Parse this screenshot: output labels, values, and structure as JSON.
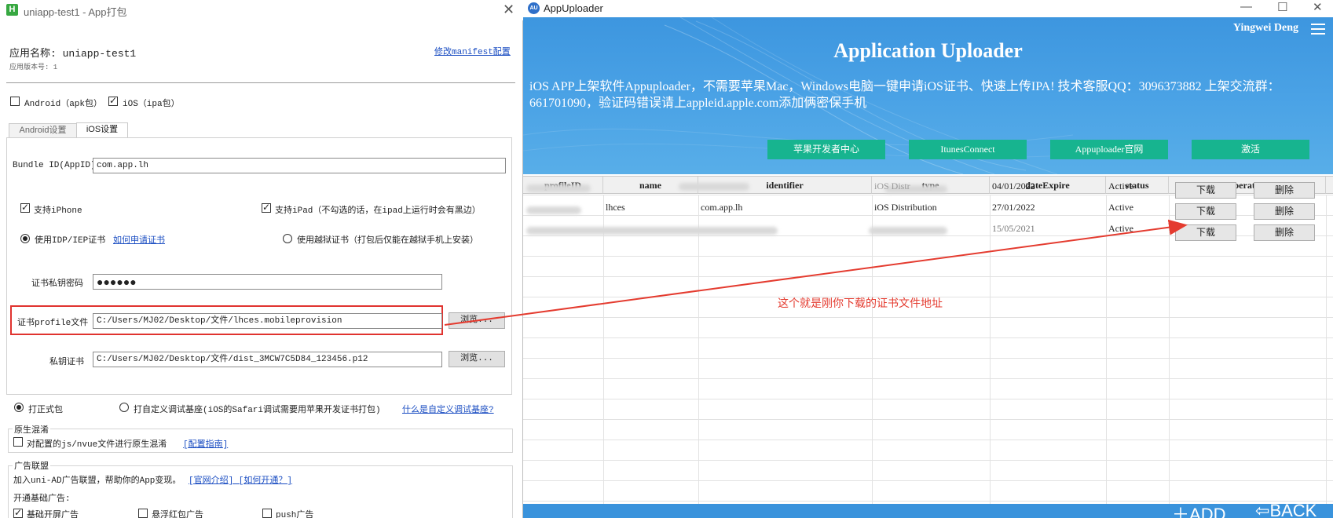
{
  "left": {
    "title": "uniapp-test1 - App打包",
    "app_icon": "H",
    "app_name_label": "应用名称: uniapp-test1",
    "app_version_label": "应用版本号: 1",
    "manifest_link": "修改manifest配置",
    "android_pkg_label": "Android（apk包）",
    "android_pkg_checked": false,
    "ios_pkg_label": "iOS（ipa包）",
    "ios_pkg_checked": true,
    "tabs": [
      {
        "label": "Android设置",
        "active": false
      },
      {
        "label": "iOS设置",
        "active": true
      }
    ],
    "bundle_id_label": "Bundle ID(AppID)",
    "bundle_id_value": "com.app.lh",
    "support_iphone_label": "支持iPhone",
    "support_iphone_checked": true,
    "support_ipad_label": "支持iPad（不勾选的话，在ipad上运行时会有黑边）",
    "support_ipad_checked": true,
    "idp_label": "使用IDP/IEP证书",
    "idp_checked": true,
    "how_apply_link": "如何申请证书",
    "jailbreak_label": "使用越狱证书（打包后仅能在越狱手机上安装）",
    "jailbreak_checked": false,
    "cert_password_label": "证书私钥密码",
    "cert_password_value": "●●●●●●",
    "profile_label": "证书profile文件",
    "profile_value": "C:/Users/MJ02/Desktop/文件/lhces.mobileprovision",
    "browse_label": "浏览...",
    "private_cert_label": "私钥证书",
    "private_cert_value": "C:/Users/MJ02/Desktop/文件/dist_3MCW7C5D84_123456.p12",
    "formal_pkg_label": "打正式包",
    "formal_pkg_checked": true,
    "custom_base_label": "打自定义调试基座(iOS的Safari调试需要用苹果开发证书打包)",
    "custom_base_checked": false,
    "custom_base_link": "什么是自定义调试基座?",
    "native_obf_title": "原生混淆",
    "native_obf_label": "对配置的js/nvue文件进行原生混淆",
    "native_obf_checked": false,
    "native_obf_link": "[配置指南]",
    "ad_title": "广告联盟",
    "ad_desc": "加入uni-AD广告联盟，帮助你的App变现。",
    "ad_links": "[官网介绍] [如何开通？]",
    "ad_basic_label": "开通基础广告:",
    "ad_options": [
      {
        "label": "基础开屏广告",
        "checked": true
      },
      {
        "label": "悬浮红包广告",
        "checked": false
      },
      {
        "label": "push广告",
        "checked": false
      }
    ]
  },
  "right": {
    "title": "AppUploader",
    "app_icon": "AU",
    "user": "Yingwei Deng",
    "banner_title": "Application Uploader",
    "banner_desc": "iOS APP上架软件Appuploader，不需要苹果Mac，Windows电脑一键申请iOS证书、快速上传IPA! 技术客服QQ：3096373882 上架交流群：661701090，验证码错误请上appleid.apple.com添加俩密保手机",
    "banner_buttons": [
      "苹果开发者中心",
      "ItunesConnect",
      "Appuploader官网",
      "激活"
    ],
    "columns": [
      "profileID",
      "name",
      "identifier",
      "type",
      "dateExpire",
      "status",
      "Operation"
    ],
    "rows": [
      {
        "profileID": "",
        "name": "",
        "identifier": "",
        "type": "iOS Distr",
        "dateExpire": "04/01/2022",
        "status": "Active"
      },
      {
        "profileID": "",
        "name": "lhces",
        "identifier": "com.app.lh",
        "type": "iOS Distribution",
        "dateExpire": "27/01/2022",
        "status": "Active"
      },
      {
        "profileID": "",
        "name": "",
        "identifier": "",
        "type": "",
        "dateExpire": "15/05/2021",
        "status": "Active"
      }
    ],
    "download_label": "下载",
    "delete_label": "删除",
    "add_label": "ADD",
    "back_label": "BACK"
  },
  "annotation": "这个就是刚你下载的证书文件地址",
  "colors": {
    "annotation_red": "#e43b2f",
    "banner_blue": "#4ba3e6",
    "banner_button_green": "#17b48f",
    "link_blue": "#1a4dc2"
  }
}
